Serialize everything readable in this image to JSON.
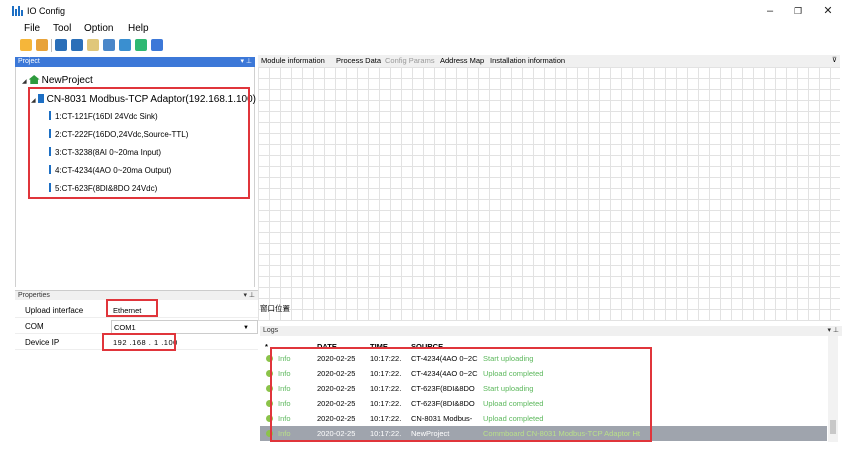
{
  "window": {
    "title": "IO Config",
    "minimize_icon": "minimize-icon",
    "maximize_icon": "restore-icon",
    "close_icon": "close-icon"
  },
  "menu": [
    "File",
    "Tool",
    "Option",
    "Help"
  ],
  "project_panel": {
    "title": "Project",
    "pin_icon": "pin-icon",
    "root": "NewProject",
    "adaptor": "CN-8031 Modbus-TCP Adaptor(192.168.1.100)",
    "modules": [
      "1:CT-121F(16DI 24Vdc Sink)",
      "2:CT-222F(16DO,24Vdc,Source-TTL)",
      "3:CT-3238(8AI 0~20ma Input)",
      "4:CT-4234(4AO 0~20ma Output)",
      "5:CT-623F(8DI&8DO 24Vdc)"
    ]
  },
  "tabs": [
    "Module information",
    "Process Data",
    "Config Params",
    "Address Map",
    "Installation information"
  ],
  "properties": {
    "title": "Properties",
    "rows": [
      {
        "label": "Upload interface",
        "value": "Ethernet"
      },
      {
        "label": "COM",
        "value": "COM1"
      },
      {
        "label": "Device IP",
        "value": "192 .168 . 1 .100"
      }
    ],
    "side_label": "窗口位置"
  },
  "logs": {
    "title": "Logs",
    "columns": [
      "*",
      "DATE",
      "TIME",
      "SOURCE"
    ],
    "rows": [
      {
        "level": "Info",
        "date": "2020-02-25",
        "time": "10:17:22.",
        "source": "CT-4234(4AO 0~2C",
        "message": "Start uploading"
      },
      {
        "level": "Info",
        "date": "2020-02-25",
        "time": "10:17:22.",
        "source": "CT-4234(4AO 0~2C",
        "message": "Upload completed"
      },
      {
        "level": "Info",
        "date": "2020-02-25",
        "time": "10:17:22.",
        "source": "CT-623F(8DI&8DO",
        "message": "Start uploading"
      },
      {
        "level": "Info",
        "date": "2020-02-25",
        "time": "10:17:22.",
        "source": "CT-623F(8DI&8DO",
        "message": "Upload completed"
      },
      {
        "level": "Info",
        "date": "2020-02-25",
        "time": "10:17:22.",
        "source": "CN-8031 Modbus-",
        "message": "Upload completed"
      },
      {
        "level": "Info",
        "date": "2020-02-25",
        "time": "10:17:22.",
        "source": "NewProject",
        "message": "Commboard CN-8031 Modbus-TCP Adaptor Ht"
      }
    ]
  },
  "colors": {
    "accent": "#3c78d8",
    "highlight": "#e0353b",
    "success": "#5cb85c"
  }
}
